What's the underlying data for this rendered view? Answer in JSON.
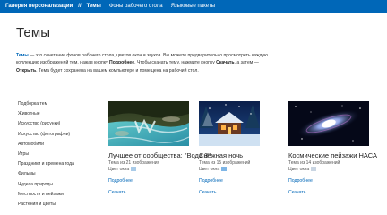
{
  "topbar": {
    "brand": "Галерея персонализации",
    "separator": "//",
    "items": [
      {
        "label": "Темы",
        "active": true
      },
      {
        "label": "Фоны рабочего стола",
        "active": false
      },
      {
        "label": "Языковые пакеты",
        "active": false
      }
    ]
  },
  "page": {
    "title": "Темы",
    "intro": {
      "p1_link": "Темы",
      "p1_text": " — это сочетание фонов рабочего стола, цветов окон и звуков. Вы можете предварительно просмотреть каждую коллекцию изображений тем, нажав кнопку ",
      "p1_bold": "Подробнее",
      "p2_text": ". Чтобы скачать тему, нажмите кнопку ",
      "p2_bold": "Скачать",
      "p3_text": ", а затем — ",
      "p3_bold": "Открыть",
      "p4_text": ". Тема будет сохранена на вашем компьютере и помещена на рабочий стол."
    }
  },
  "sidebar": {
    "items": [
      {
        "label": "Подборка тем"
      },
      {
        "label": "Животные"
      },
      {
        "label": "Искусство (рисунки)"
      },
      {
        "label": "Искусство (фотографии)"
      },
      {
        "label": "Автомобили"
      },
      {
        "label": "Игры"
      },
      {
        "label": "Праздники и времена года"
      },
      {
        "label": "Фильмы"
      },
      {
        "label": "Чудеса природы"
      },
      {
        "label": "Местности и пейзажи"
      },
      {
        "label": "Растения и цветы"
      }
    ]
  },
  "themes": [
    {
      "name": "Лучшее от сообщества: \"Вода 3\"",
      "count": "Тема из 21 изображения",
      "color_label": "Цвет окна",
      "swatch_color": "#a9cbe8",
      "details": "Подробнее",
      "download": "Скачать"
    },
    {
      "name": "Снежная ночь",
      "count": "Тема из 15 изображений",
      "color_label": "Цвет окна",
      "swatch_color": "#7fb6e6",
      "details": "Подробнее",
      "download": "Скачать"
    },
    {
      "name": "Космические пейзажи НАСА",
      "count": "Тема из 14 изображений",
      "color_label": "Цвет окна",
      "swatch_color": "#c9d5e2",
      "details": "Подробнее",
      "download": "Скачать"
    }
  ],
  "colors": {
    "accent": "#0067b8",
    "topbar_bg": "#0067b8"
  }
}
